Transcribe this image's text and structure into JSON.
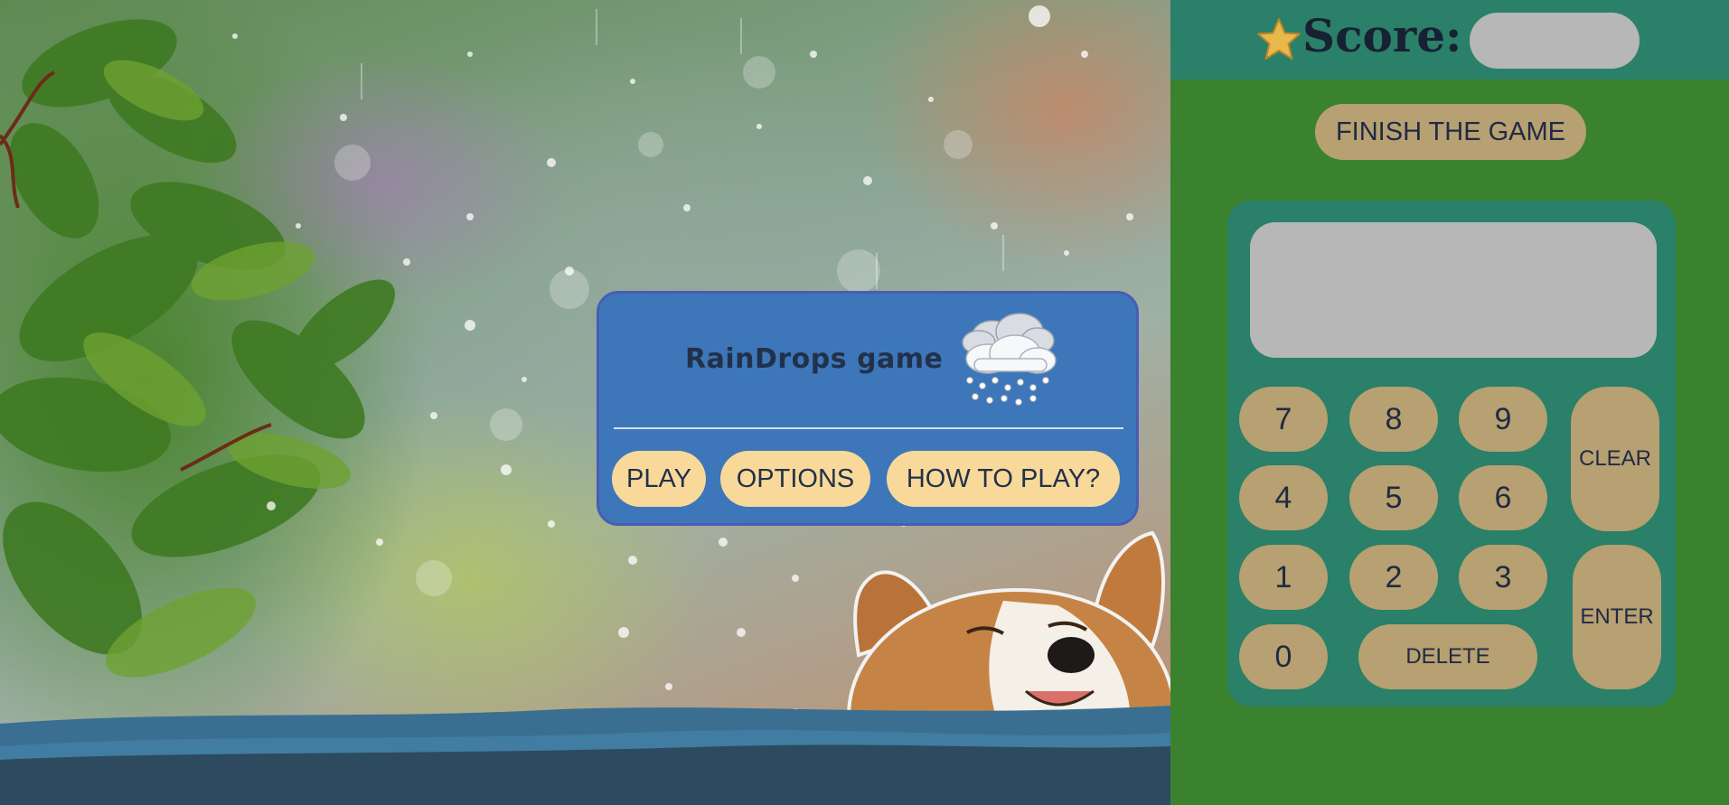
{
  "menu": {
    "title": "RainDrops game",
    "icon": "snow-cloud-icon",
    "buttons": {
      "play": "PLAY",
      "options": "OPTIONS",
      "how_to_play": "HOW TO PLAY?"
    }
  },
  "score": {
    "label": "Score:",
    "icon": "star-icon",
    "value": ""
  },
  "finish_button": "FINISH THE GAME",
  "calculator": {
    "display_value": "",
    "keys": {
      "k7": "7",
      "k8": "8",
      "k9": "9",
      "k4": "4",
      "k5": "5",
      "k6": "6",
      "k1": "1",
      "k2": "2",
      "k3": "3",
      "k0": "0",
      "delete": "DELETE",
      "clear": "CLEAR",
      "enter": "ENTER"
    }
  },
  "colors": {
    "panel_green": "#3b822f",
    "teal": "#2a8069",
    "key_tan": "#b7a071",
    "menu_blue": "#3d77b9",
    "menu_button": "#f9d99a",
    "display_gray": "#b7b7b7",
    "water_dark": "#2d4a5e"
  }
}
